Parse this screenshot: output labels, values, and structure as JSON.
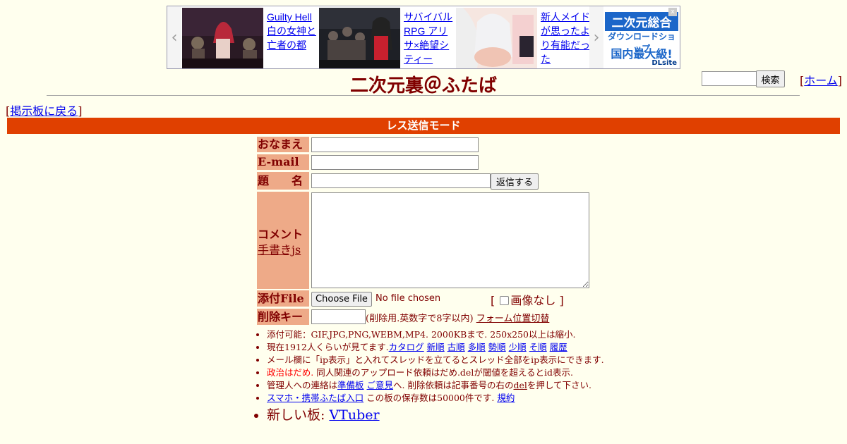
{
  "ad": {
    "items": [
      {
        "title": "Guilty Hell 白の女神と亡者の都"
      },
      {
        "title": "サバイバルRPG アリサ×絶望シティー"
      },
      {
        "title": "新人メイドが思ったより有能だった"
      }
    ],
    "dlsite": {
      "line1": "二次元総合",
      "line2": "ダウンロードショップ",
      "line3": "国内最大級!",
      "logo": "DLsite"
    },
    "prev_arrow": "‹",
    "next_arrow": "›",
    "close": "x"
  },
  "header": {
    "title": "二次元裏＠ふたば",
    "search_button": "検索",
    "home_open": "[",
    "home_link": "ホーム",
    "home_close": "]"
  },
  "nav": {
    "back_open": "[",
    "back_link": "掲示板に戻る",
    "back_close": "]"
  },
  "mode_bar": "レス送信モード",
  "form": {
    "name_label": "おなまえ",
    "email_label": "E-mail",
    "subject_label": "題　　名",
    "submit_label": "返信する",
    "comment_label": "コメント",
    "handwriting_link": "手書きjs",
    "file_label": "添付File",
    "choose_file": "Choose File",
    "no_file": "No file chosen",
    "noimage_open": "[",
    "noimage_label": "画像なし",
    "noimage_close": "]",
    "delkey_label": "削除キー",
    "delkey_note": "(削除用.英数字で8字以内)",
    "form_toggle": "フォーム位置切替"
  },
  "notes": {
    "n1": "添付可能：GIF,JPG,PNG,WEBM,MP4. 2000KBまで. 250x250以上は縮小.",
    "n2_prefix": "現在1912人くらいが見てます.",
    "n2_links": [
      "カタログ",
      "新順",
      "古順",
      "多順",
      "勢順",
      "少順",
      "そ順",
      "履歴"
    ],
    "n3": "メール欄に「ip表示」と入れてスレッドを立てるとスレッド全部をip表示にできます.",
    "n4_red": "政治はだめ.",
    "n4_rest": " 同人関連のアップロード依頼はだめ.delが閾値を超えるとid表示.",
    "n5_a": "管理人への連絡は",
    "n5_link1": "準備板",
    "n5_link2": "ご意見",
    "n5_b": "へ. 削除依頼は記事番号の右の",
    "n5_del": "del",
    "n5_c": "を押して下さい.",
    "n6_link": "スマホ・携帯ふたば入口",
    "n6_mid": " この板の保存数は50000件です. ",
    "n6_terms": "規約",
    "n7_prefix": "新しい板: ",
    "n7_link": "VTuber"
  },
  "colors": {
    "background": "#ffffee",
    "text": "#800000",
    "label_bg": "#eeaa88",
    "mode_bar": "#e04000",
    "link": "#0000ee"
  }
}
